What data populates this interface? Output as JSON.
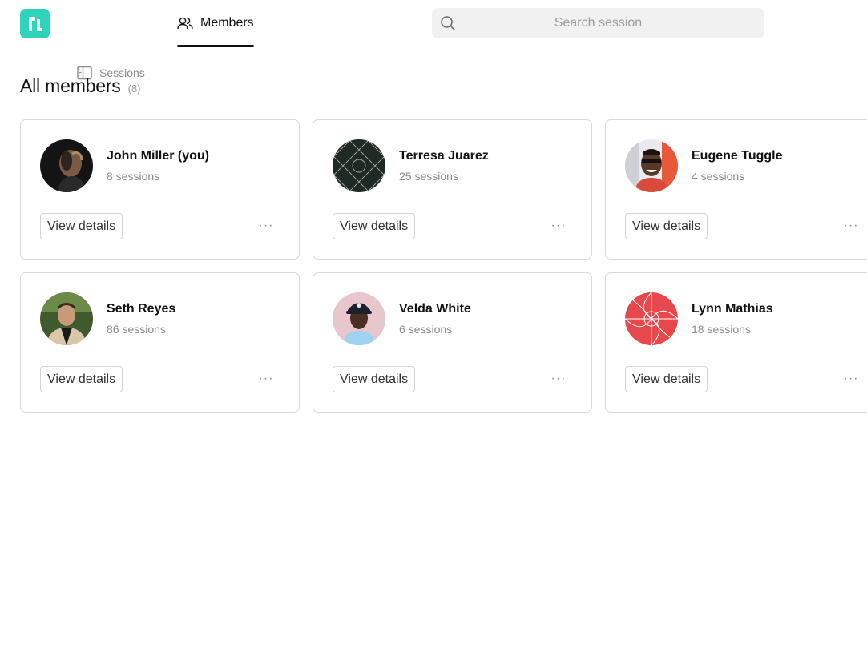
{
  "nav": {
    "tabs": [
      {
        "label": "Sessions",
        "icon": "sidebar-panel-icon",
        "active": false
      },
      {
        "label": "Members",
        "icon": "users-icon",
        "active": true
      }
    ]
  },
  "search": {
    "placeholder": "Search session",
    "value": ""
  },
  "page": {
    "title": "All members",
    "count": "(8)"
  },
  "members": [
    {
      "name": "John Miller (you)",
      "sessions": "8 sessions",
      "button": "View details",
      "more": "···"
    },
    {
      "name": "Terresa Juarez",
      "sessions": "25 sessions",
      "button": "View details",
      "more": "···"
    },
    {
      "name": "Eugene Tuggle",
      "sessions": "4 sessions",
      "button": "View details",
      "more": "···"
    },
    {
      "name": "Seth Reyes",
      "sessions": "86 sessions",
      "button": "View details",
      "more": "···"
    },
    {
      "name": "Velda White",
      "sessions": "6 sessions",
      "button": "View details",
      "more": "···"
    },
    {
      "name": "Lynn Mathias",
      "sessions": "18 sessions",
      "button": "View details",
      "more": "···"
    }
  ],
  "colors": {
    "brand": "#2fd3b9",
    "pattern_dark": "#1f2a24",
    "pattern_red": "#e8474b",
    "text": "#111111",
    "muted": "#8a8a8f"
  }
}
